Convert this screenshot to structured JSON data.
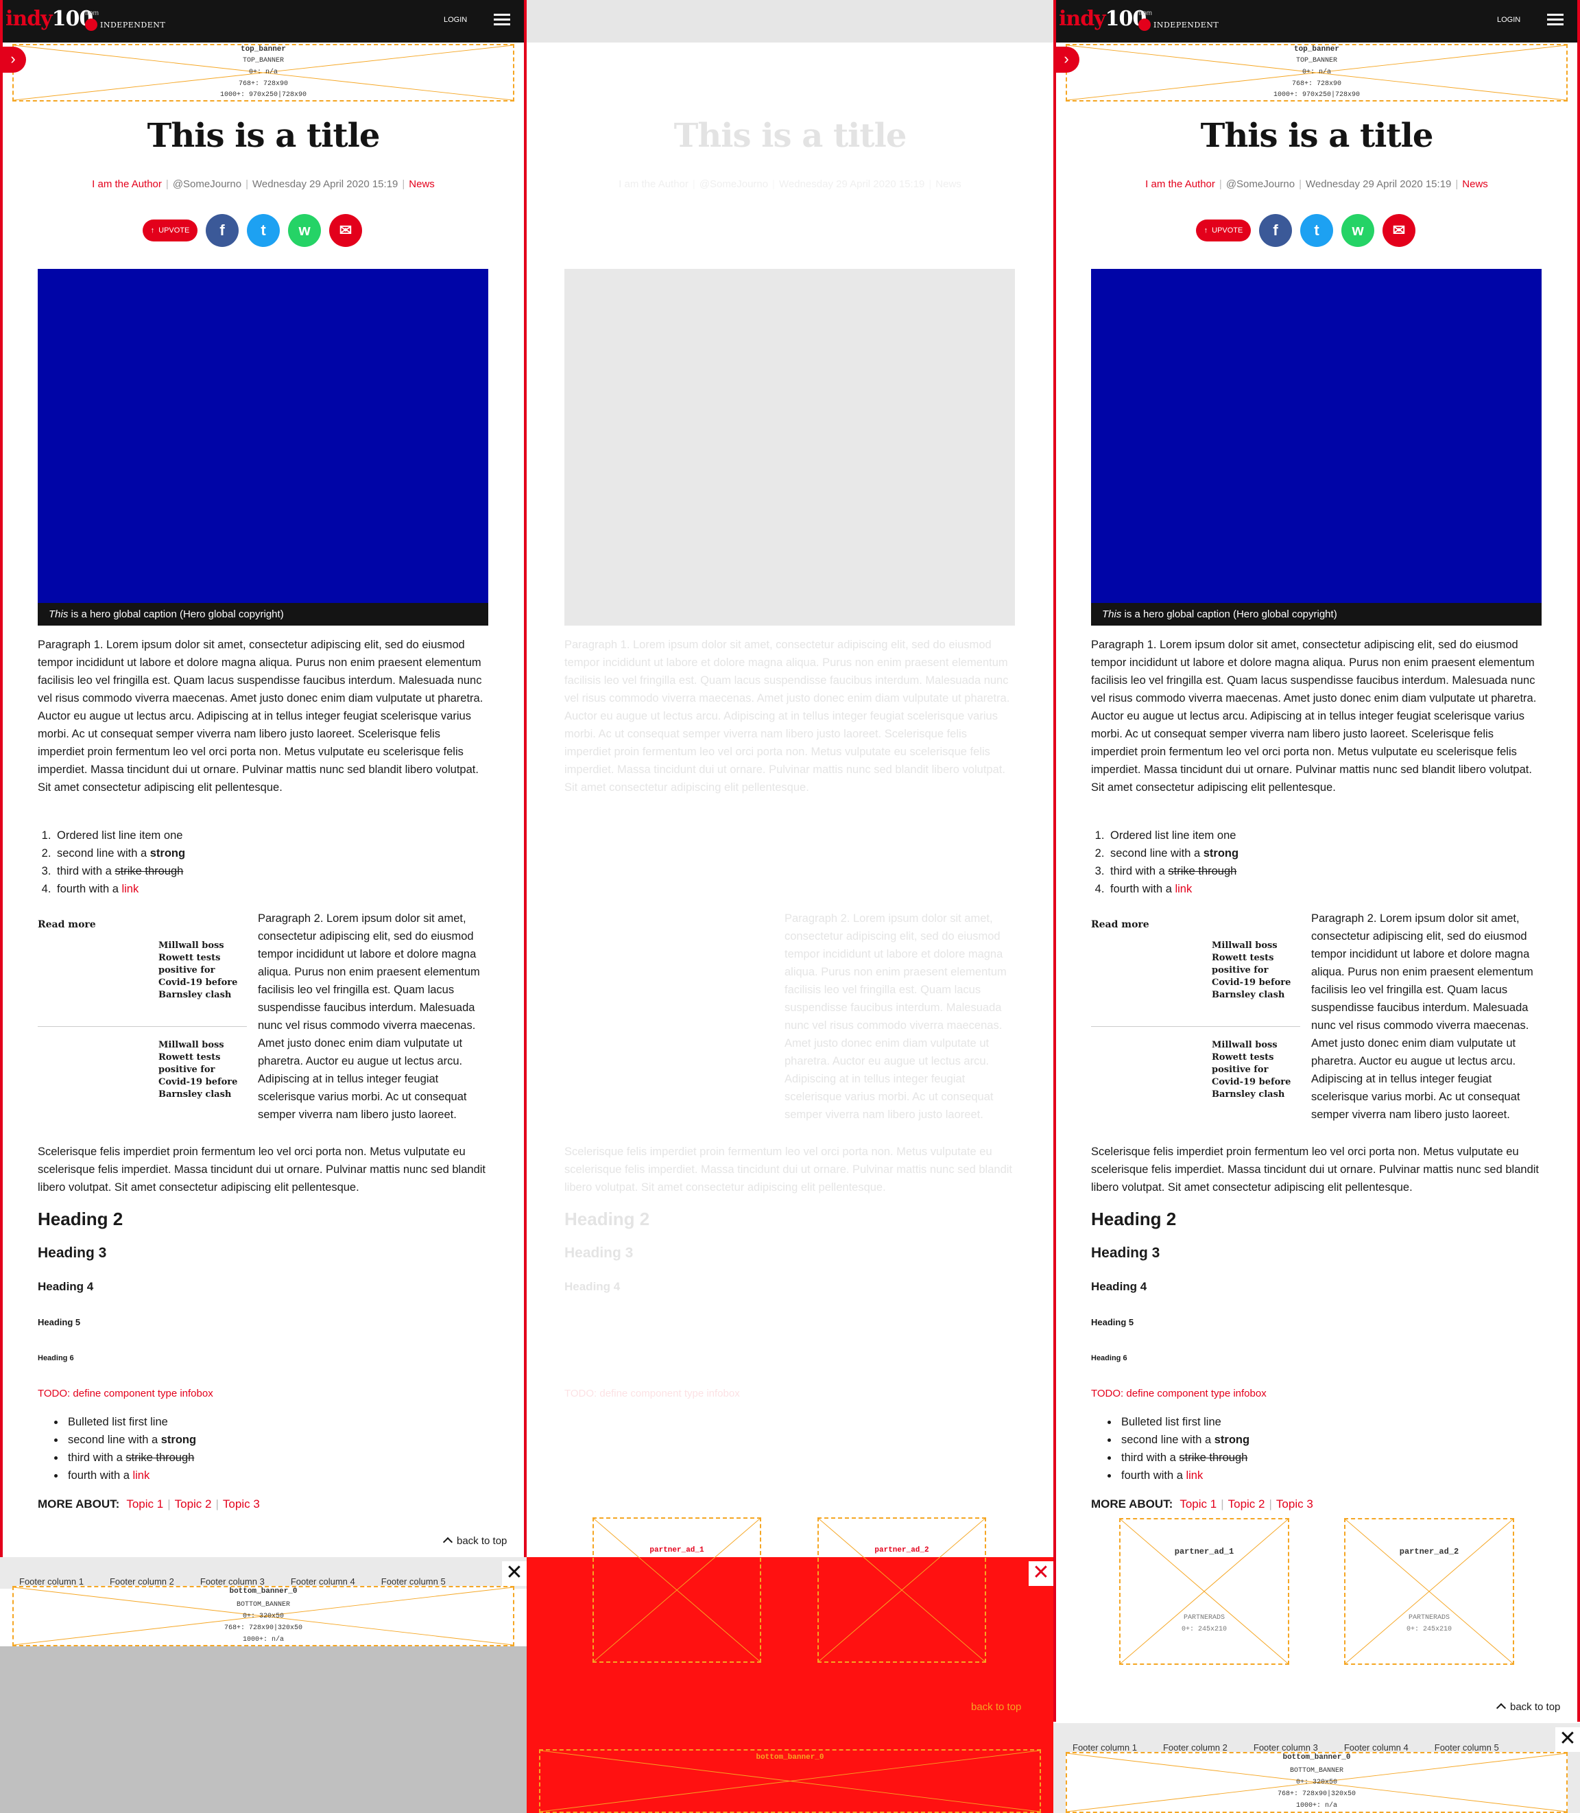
{
  "header": {
    "logo_indy": "indy",
    "logo_num": "100",
    "from": "from",
    "independent": "INDEPENDENT",
    "login": "LOGIN"
  },
  "top_ad": {
    "name": "top_banner",
    "slot": "TOP_BANNER",
    "rule1": "0+: n/a",
    "rule2": "768+: 728x90",
    "rule3": "1000+: 970x250|728x90"
  },
  "article": {
    "title": "This is a title",
    "author": "I am the Author",
    "handle": "@SomeJourno",
    "date": "Wednesday 29 April 2020 15:19",
    "section": "News",
    "upvote": "UPVOTE",
    "caption_em": "This",
    "caption_rest": " is a hero global caption (Hero global copyright)",
    "p1": "Paragraph 1. Lorem ipsum dolor sit amet, consectetur adipiscing elit, sed do eiusmod tempor incididunt ut labore et dolore magna aliqua. Purus non enim praesent elementum facilisis leo vel fringilla est. Quam lacus suspendisse faucibus interdum. Malesuada nunc vel risus commodo viverra maecenas. Amet justo donec enim diam vulputate ut pharetra. Auctor eu augue ut lectus arcu. Adipiscing at in tellus integer feugiat scelerisque varius morbi. Ac ut consequat semper viverra nam libero justo laoreet. Scelerisque felis imperdiet proin fermentum leo vel orci porta non. Metus vulputate eu scelerisque felis imperdiet. Massa tincidunt dui ut ornare. Pulvinar mattis nunc sed blandit libero volutpat. Sit amet consectetur adipiscing elit pellentesque.",
    "ol": {
      "i1": "Ordered list line item one",
      "i2_pre": "second line with a ",
      "i2_strong": "strong",
      "i3_pre": "third with a ",
      "i3_strike": "strike through",
      "i4_pre": "fourth with a ",
      "i4_link": "link"
    },
    "read_more": "Read more",
    "rm1": "Millwall boss Rowett tests positive for Covid-19 before Barnsley clash",
    "rm2": "Millwall boss Rowett tests positive for Covid-19 before Barnsley clash",
    "p2": "Paragraph 2. Lorem ipsum dolor sit amet, consectetur adipiscing elit, sed do eiusmod tempor incididunt ut labore et dolore magna aliqua. Purus non enim praesent elementum facilisis leo vel fringilla est. Quam lacus suspendisse faucibus interdum. Malesuada nunc vel risus commodo viverra maecenas. Amet justo donec enim diam vulputate ut pharetra. Auctor eu augue ut lectus arcu. Adipiscing at in tellus integer feugiat scelerisque varius morbi. Ac ut consequat semper viverra nam libero justo laoreet.",
    "p2_cont": "Scelerisque felis imperdiet proin fermentum leo vel orci porta non. Metus vulputate eu scelerisque felis imperdiet. Massa tincidunt dui ut ornare. Pulvinar mattis nunc sed blandit libero volutpat. Sit amet consectetur adipiscing elit pellentesque.",
    "h2": "Heading 2",
    "h3": "Heading 3",
    "h4": "Heading 4",
    "h5": "Heading 5",
    "h6": "Heading 6",
    "todo": "TODO: define component type infobox",
    "ul": {
      "i1": "Bulleted list first line",
      "i2_pre": "second line with a ",
      "i2_strong": "strong",
      "i3_pre": "third with a ",
      "i3_strike": "strike through",
      "i4_pre": "fourth with a ",
      "i4_link": "link"
    },
    "more_about": "MORE ABOUT:",
    "topics": [
      "Topic 1",
      "Topic 2",
      "Topic 3"
    ],
    "back_to_top": "back to top"
  },
  "partner_ads": [
    {
      "name": "partner_ad_1",
      "slot": "PARTNERADS",
      "rule": "0+: 245x210"
    },
    {
      "name": "partner_ad_2",
      "slot": "PARTNERADS",
      "rule": "0+: 245x210"
    }
  ],
  "footer": {
    "cols": [
      "Footer column 1",
      "Footer column 2",
      "Footer column 3",
      "Footer column 4",
      "Footer column 5"
    ],
    "close": "✕"
  },
  "bottom_ad": {
    "name": "bottom_banner_0",
    "slot": "BOTTOM_BANNER",
    "rule1": "0+: 320x50",
    "rule2": "768+: 728x90|320x50",
    "rule3": "1000+: n/a"
  },
  "colors": {
    "brand_red": "#e3001b",
    "hero_blue": "#0005a7",
    "header_black": "#141414",
    "ad_orange": "#f5a623"
  }
}
